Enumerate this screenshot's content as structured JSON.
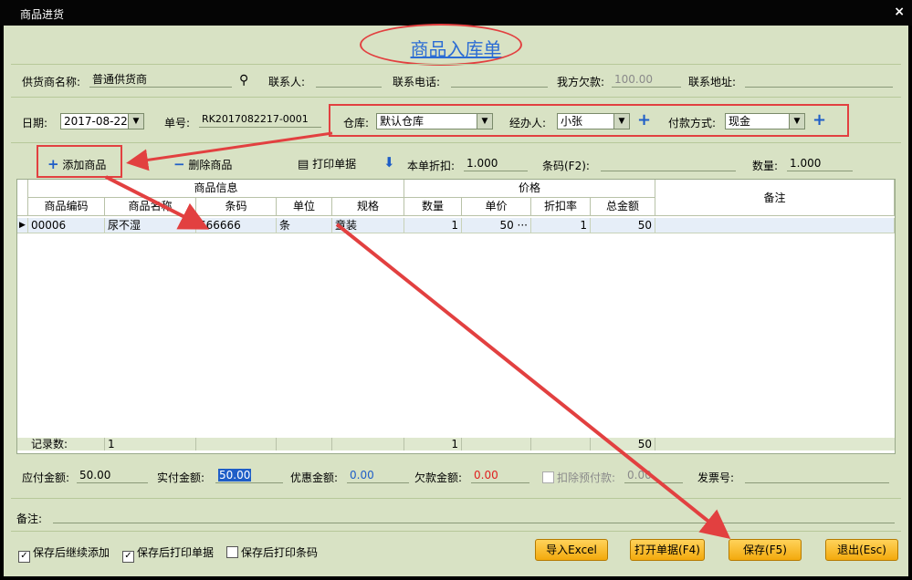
{
  "window": {
    "title": "商品进货",
    "close": "×"
  },
  "heading": "商品入库单",
  "row1": {
    "supplier_label": "供货商名称:",
    "supplier_value": "普通供货商",
    "contact_label": "联系人:",
    "contact_value": "",
    "phone_label": "联系电话:",
    "phone_value": "",
    "debt_label": "我方欠款:",
    "debt_value": "100.00",
    "address_label": "联系地址:",
    "address_value": ""
  },
  "row2": {
    "date_label": "日期:",
    "date_value": "2017-08-22",
    "no_label": "单号:",
    "no_value": "RK2017082217-0001",
    "warehouse_label": "仓库:",
    "warehouse_value": "默认仓库",
    "handler_label": "经办人:",
    "handler_value": "小张",
    "pay_label": "付款方式:",
    "pay_value": "现金"
  },
  "toolbar": {
    "add": "添加商品",
    "delete": "删除商品",
    "print": "打印单据",
    "discount_label": "本单折扣:",
    "discount_value": "1.000",
    "barcode_label": "条码(F2):",
    "barcode_value": "",
    "qty_label": "数量:",
    "qty_value": "1.000"
  },
  "grid": {
    "group_info": "商品信息",
    "group_price": "价格",
    "remark": "备注",
    "cols": [
      "商品编码",
      "商品名称",
      "条码",
      "单位",
      "规格",
      "数量",
      "单价",
      "折扣率",
      "总金额"
    ],
    "row": {
      "code": "00006",
      "name": "尿不湿",
      "barcode": "666666",
      "unit": "条",
      "spec": "童装",
      "qty": "1",
      "price": "50",
      "price_more": "···",
      "rate": "1",
      "total": "50"
    },
    "footer": {
      "label": "记录数:",
      "count": "1",
      "qty": "1",
      "total": "50"
    }
  },
  "totals": {
    "due_label": "应付金额:",
    "due_value": "50.00",
    "paid_label": "实付金额:",
    "paid_value": "50.00",
    "discount_label": "优惠金额:",
    "discount_value": "0.00",
    "owed_label": "欠款金额:",
    "owed_value": "0.00",
    "prepay_label": "扣除预付款:",
    "prepay_value": "0.00",
    "invoice_label": "发票号:",
    "invoice_value": ""
  },
  "remark": {
    "label": "备注:",
    "value": ""
  },
  "options": {
    "continue_add": "保存后继续添加",
    "print_doc": "保存后打印单据",
    "print_barcode": "保存后打印条码"
  },
  "buttons": {
    "import": "导入Excel",
    "open": "打开单据(F4)",
    "save": "保存(F5)",
    "exit": "退出(Esc)"
  },
  "colors": {
    "accent": "#1f5ec7",
    "annotation": "#e24040",
    "background": "#d8e2c4",
    "button": "#f3a90d"
  }
}
